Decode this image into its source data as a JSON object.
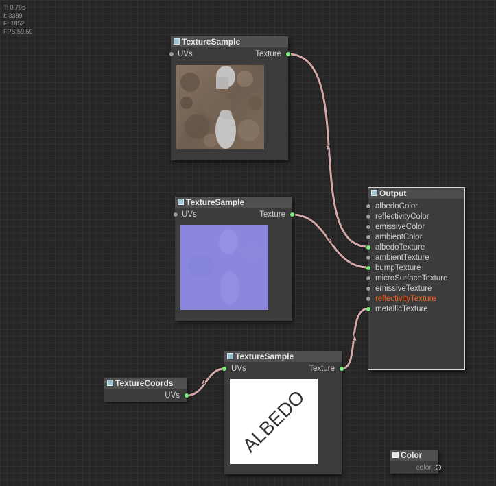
{
  "stats": {
    "time": "T: 0.79s",
    "iterations": "I: 3389",
    "frames": "F: 1852",
    "fps": "FPS:59.59"
  },
  "nodes": {
    "texture_sample_1": {
      "title": "TextureSample",
      "input": "UVs",
      "output": "Texture",
      "preview": "concrete-texture"
    },
    "texture_sample_2": {
      "title": "TextureSample",
      "input": "UVs",
      "output": "Texture",
      "preview": "normal-map-texture"
    },
    "texture_sample_3": {
      "title": "TextureSample",
      "input": "UVs",
      "output": "Texture",
      "preview_text": "ALBEDO"
    },
    "texture_coords": {
      "title": "TextureCoords",
      "output": "UVs"
    },
    "output": {
      "title": "Output",
      "inputs": [
        "albedoColor",
        "reflectivityColor",
        "emissiveColor",
        "ambientColor",
        "albedoTexture",
        "ambientTexture",
        "bumpTexture",
        "microSurfaceTexture",
        "emissiveTexture",
        "reflectivityTexture",
        "metallicTexture"
      ],
      "highlighted_input": "reflectivityTexture"
    },
    "color": {
      "title": "Color",
      "output": "color"
    }
  },
  "colors": {
    "background": "#262626",
    "node_body": "#3b3b3b",
    "node_title": "#505050",
    "link": "#d4a8a8",
    "slot_connected": "#7df07d",
    "slot_empty": "#9c9c9c",
    "highlight_text": "#ff5a1e"
  }
}
